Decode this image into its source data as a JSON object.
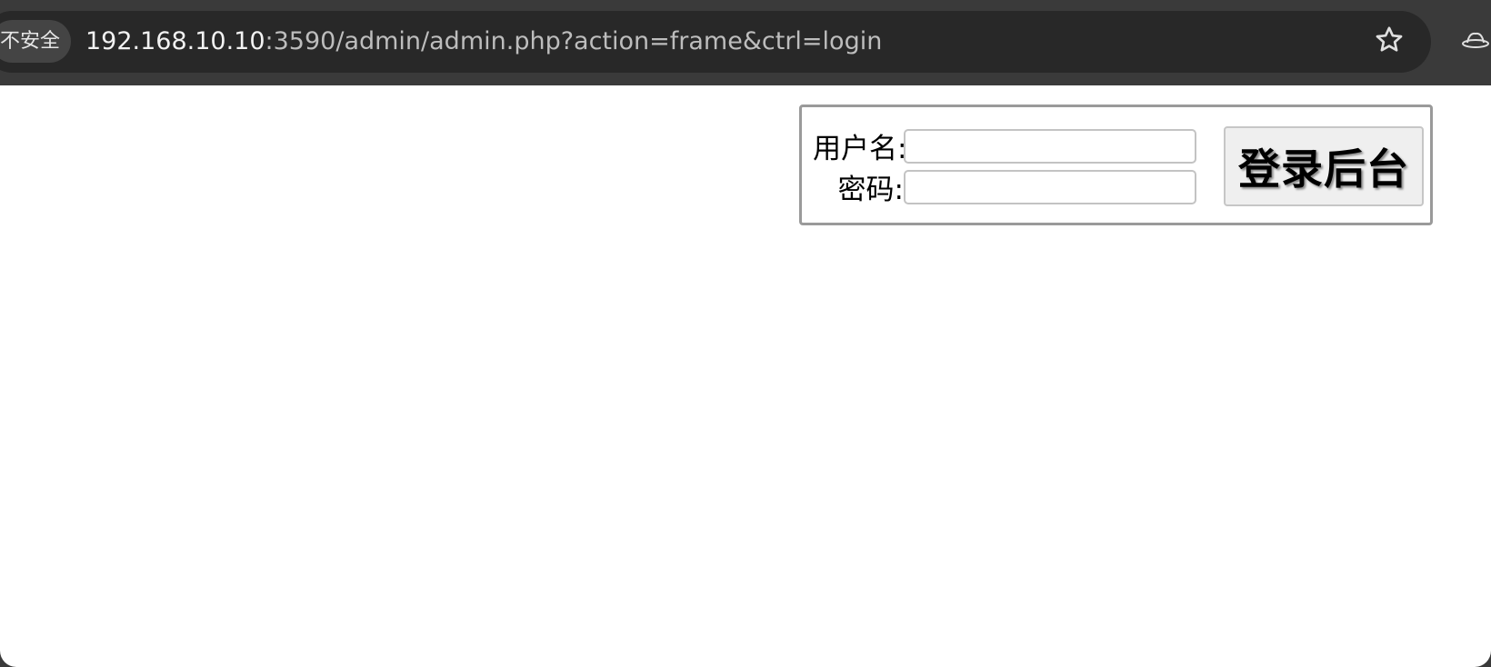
{
  "browser": {
    "security_label": "不安全",
    "url_host": "192.168.10.10",
    "url_rest": ":3590/admin/admin.php?action=frame&ctrl=login",
    "bookmark_icon": "star-icon",
    "extension_icon": "incognito-hat-icon"
  },
  "login": {
    "username_label": "用户名:",
    "password_label": "密码:",
    "username_value": "",
    "password_value": "",
    "submit_label": "登录后台"
  },
  "colors": {
    "toolbar_bg": "#3a3a3a",
    "omnibox_bg": "#282828",
    "page_bg": "#ffffff",
    "box_border": "#9a9a9a"
  }
}
